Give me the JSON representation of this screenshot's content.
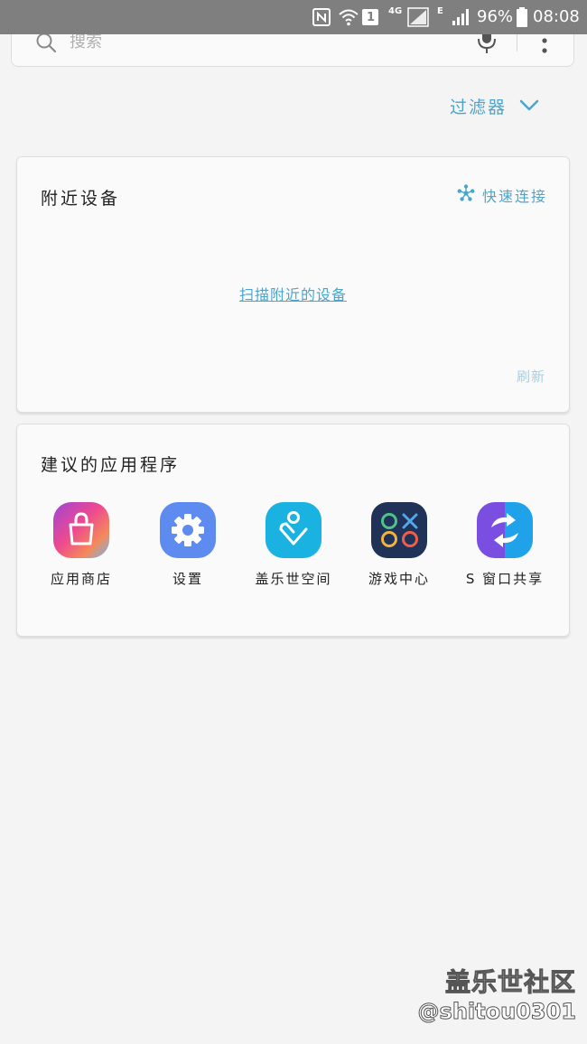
{
  "status_bar": {
    "sim_slot": "1",
    "network_4g": "4G",
    "network_e": "E",
    "battery": "96%",
    "time": "08:08",
    "icons": [
      "nfc-icon",
      "wifi-icon",
      "sim-icon",
      "signal-icon",
      "battery-icon"
    ]
  },
  "search": {
    "placeholder": "搜索",
    "value": "",
    "icons": [
      "search-icon",
      "mic-icon",
      "more-vertical-icon"
    ]
  },
  "filter": {
    "label": "过滤器",
    "icon": "chevron-down-icon"
  },
  "nearby_devices": {
    "title": "附近设备",
    "quick_connect": "快速连接",
    "quick_connect_icon": "quick-connect-icon",
    "scan_link": "扫描附近的设备",
    "refresh": "刷新"
  },
  "suggested_apps": {
    "title": "建议的应用程序",
    "apps": [
      {
        "label": "应用商店",
        "icon": "app-store-icon"
      },
      {
        "label": "设置",
        "icon": "settings-icon"
      },
      {
        "label": "盖乐世空间",
        "icon": "galaxy-space-icon"
      },
      {
        "label": "游戏中心",
        "icon": "game-center-icon"
      },
      {
        "label": "S 窗口共享",
        "icon": "window-share-icon"
      }
    ]
  },
  "watermark": {
    "title": "盖乐世社区",
    "handle": "@shitou0301"
  },
  "colors": {
    "accent": "#4aa6cc",
    "status_bar_bg": "#7f7f7f",
    "page_bg": "#f4f4f4",
    "card_bg": "#fafafa"
  }
}
